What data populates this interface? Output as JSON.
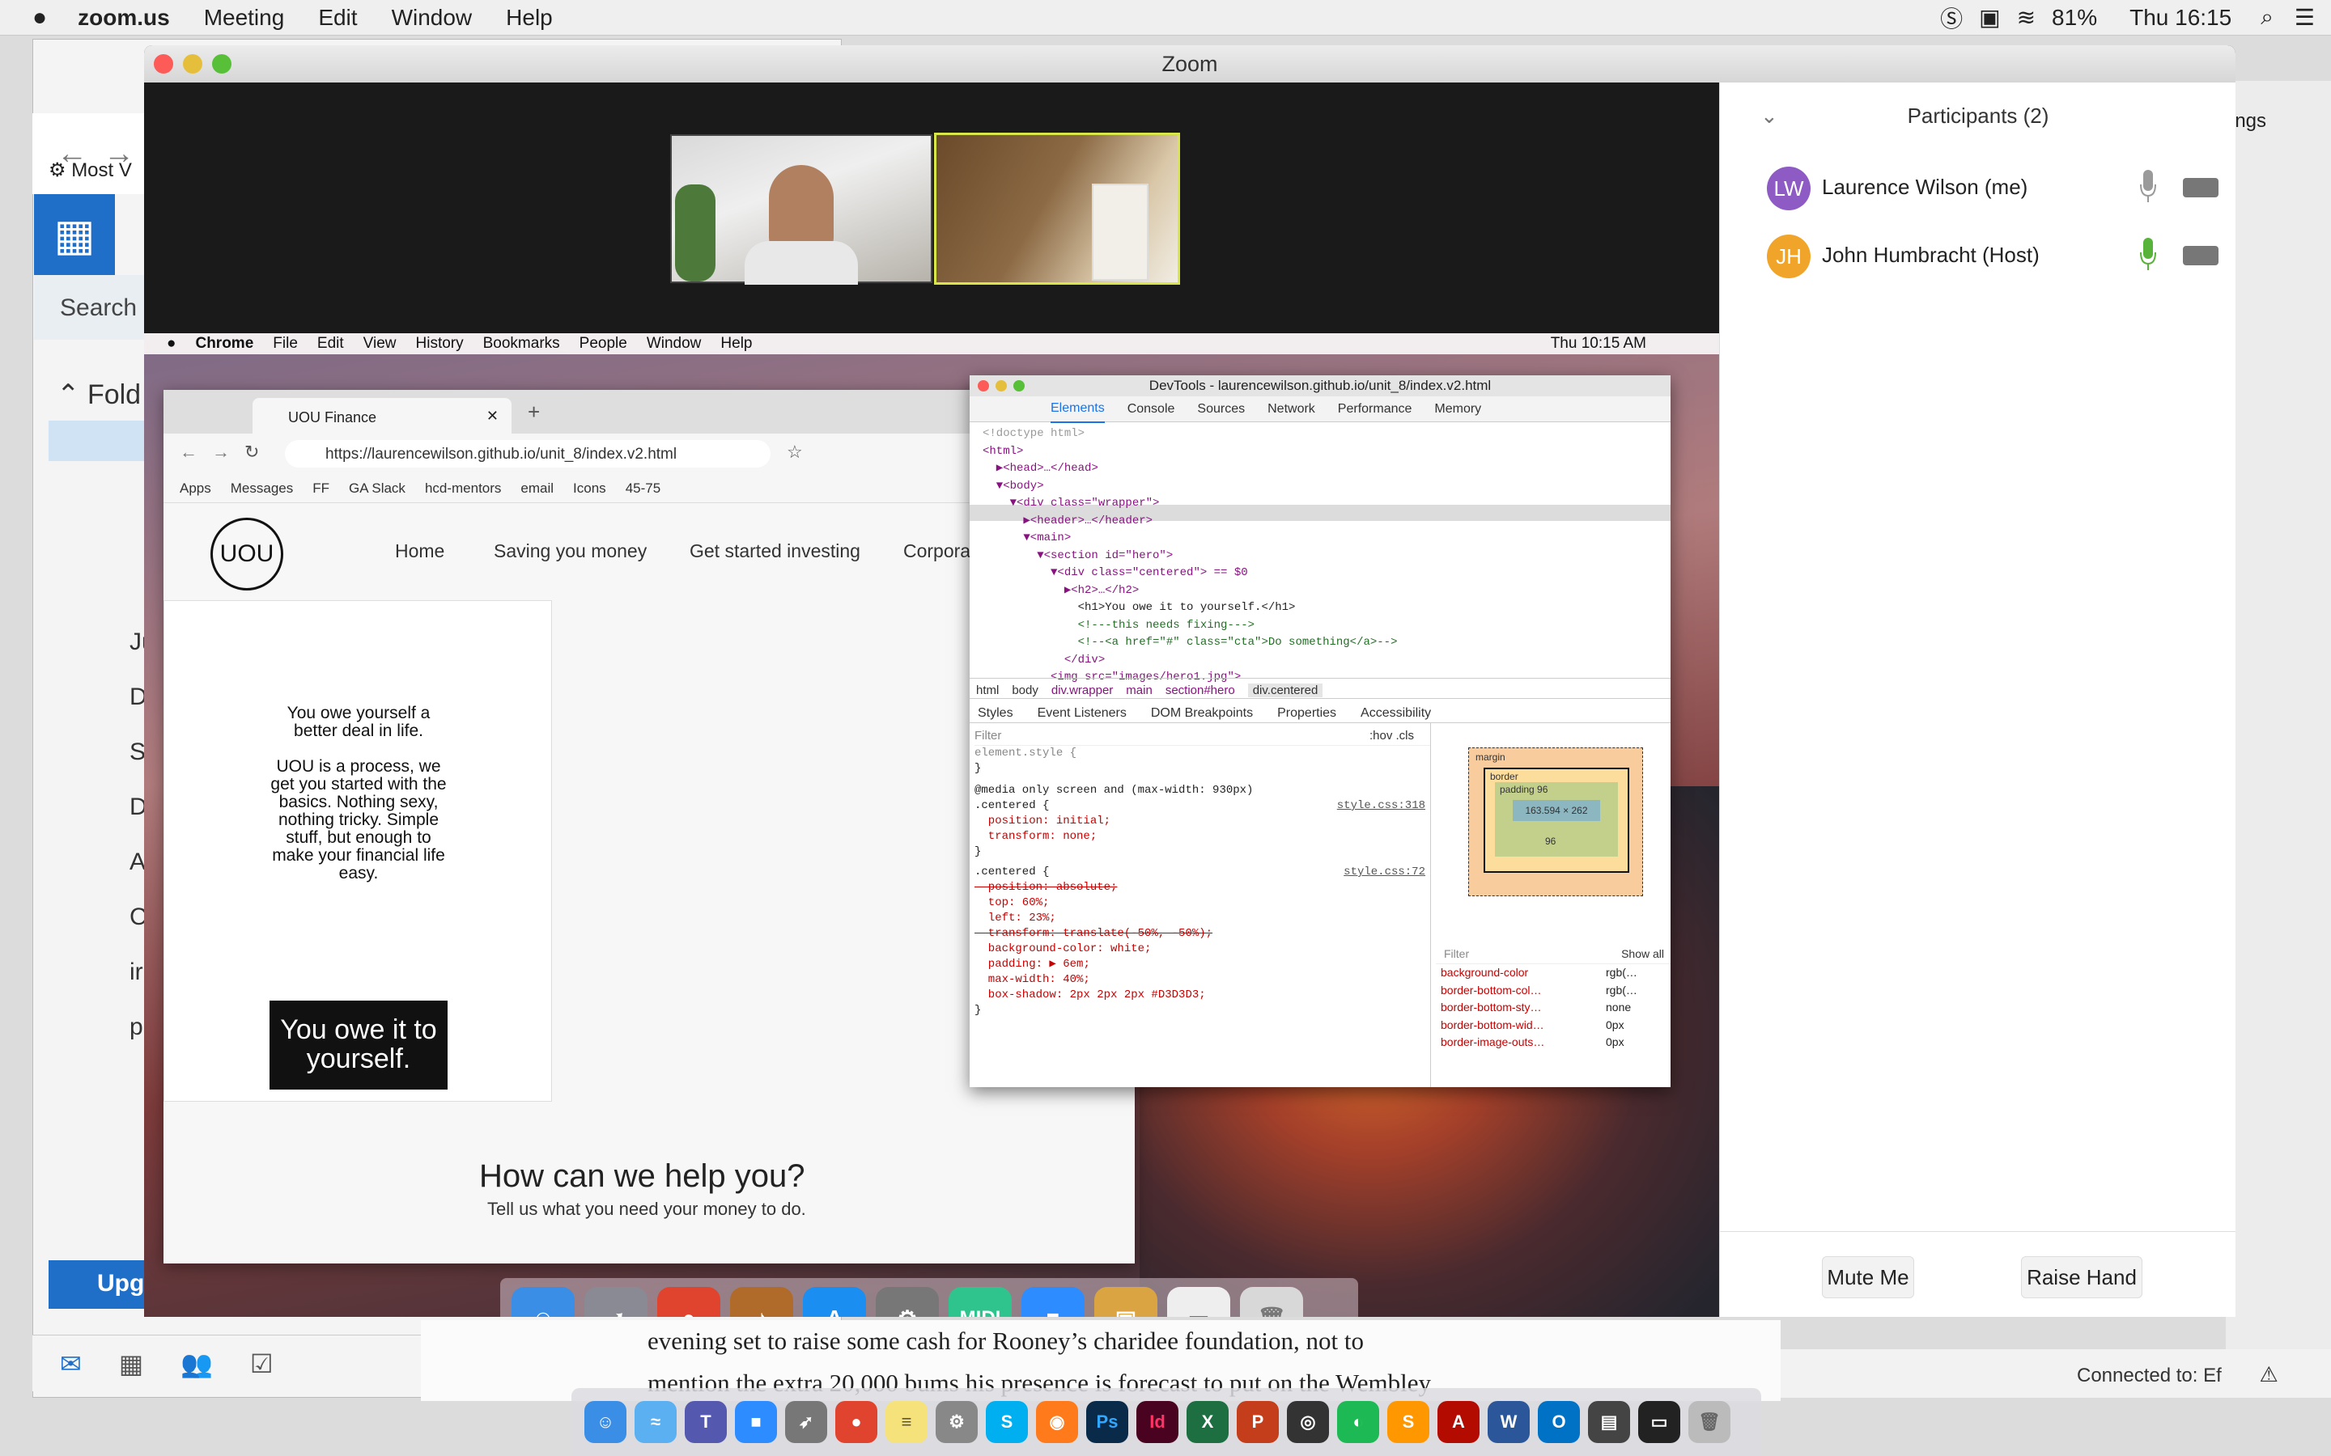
{
  "mac_menubar": {
    "app": "zoom.us",
    "items": [
      "Meeting",
      "Edit",
      "Window",
      "Help"
    ],
    "battery": "81%",
    "clock": "Thu 16:15"
  },
  "background": {
    "outlook": {
      "nav_label": "Most V",
      "folders_label": "Fold",
      "search_label": "Search M",
      "upgrade_label": "Upg",
      "side_letters": [
        "Ju",
        "D",
        "S",
        "D",
        "A",
        "C",
        "ir",
        "p"
      ]
    },
    "article_lines": [
      "evening set to raise some cash for Rooney’s charidee foundation, not to",
      "mention the extra 20,000 bums his presence is forecast to put on the Wembley"
    ],
    "connected_label": "Connected to: Ef",
    "right_snippet": "ings"
  },
  "zoom": {
    "window_title": "Zoom",
    "participants_title": "Participants (2)",
    "participants": [
      {
        "initials": "LW",
        "name": "Laurence Wilson (me)",
        "avatar_color": "#8e5bc4",
        "mic_color": "#999999"
      },
      {
        "initials": "JH",
        "name": "John Humbracht (Host)",
        "avatar_color": "#f0a52a",
        "mic_color": "#58b33a"
      }
    ],
    "mute_label": "Mute Me",
    "raise_hand_label": "Raise Hand"
  },
  "shared_screen": {
    "mac_menubar": {
      "app": "Chrome",
      "items": [
        "File",
        "Edit",
        "View",
        "History",
        "Bookmarks",
        "People",
        "Window",
        "Help"
      ],
      "clock": "Thu 10:15 AM"
    },
    "chrome": {
      "tab_title": "UOU Finance",
      "url": "https://laurencewilson.github.io/unit_8/index.v2.html",
      "bookmarks": [
        "Apps",
        "Messages",
        "FF",
        "GA Slack",
        "hcd-mentors",
        "email",
        "Icons",
        "45-75"
      ],
      "site": {
        "logo": "UOU",
        "nav": [
          "Home",
          "Saving you money",
          "Get started investing",
          "Corpora"
        ],
        "card_heading": "You owe yourself a better deal in life.",
        "card_body": "UOU is a process, we get you started with the basics. Nothing sexy, nothing tricky. Simple stuff, but enough to make your financial life easy.",
        "cta": "You owe it to yourself.",
        "help_title": "How can we help you?",
        "help_sub": "Tell us what you need your money to do."
      }
    },
    "devtools": {
      "title": "DevTools - laurencewilson.github.io/unit_8/index.v2.html",
      "tabs": [
        "Elements",
        "Console",
        "Sources",
        "Network",
        "Performance",
        "Memory"
      ],
      "dom_lines": [
        "<!doctype html>",
        "<html>",
        "  ▶<head>…</head>",
        "  ▼<body>",
        "    ▼<div class=\"wrapper\">",
        "      ▶<header>…</header>",
        "      ▼<main>",
        "        ▼<section id=\"hero\">",
        "          ▼<div class=\"centered\"> == $0",
        "            ▶<h2>…</h2>",
        "              <h1>You owe it to yourself.</h1>",
        "              <!---this needs fixing--->",
        "              <!--<a href=\"#\" class=\"cta\">Do something</a>-->",
        "            </div>",
        "          <img src=\"images/hero1.jpg\">"
      ],
      "breadcrumbs": [
        "html",
        "body",
        "div.wrapper",
        "main",
        "section#hero",
        "div.centered"
      ],
      "sub_tabs": [
        "Styles",
        "Event Listeners",
        "DOM Breakpoints",
        "Properties",
        "Accessibility"
      ],
      "filter_placeholder": "Filter",
      "hov_cls": ":hov  .cls",
      "styles": [
        "element.style {",
        "}",
        "@media only screen and (max-width: 930px)",
        ".centered {",
        "  position: initial;",
        "  transform: none;",
        "}",
        ".centered {",
        "  position: absolute;",
        "  top: 60%;",
        "  left: 23%;",
        "  transform: translate(-50%, -50%);",
        "  background-color: white;",
        "  padding: ▶ 6em;",
        "  max-width: 40%;",
        "  box-shadow: 2px 2px 2px #D3D3D3;",
        "}"
      ],
      "style_sources": [
        "style.css:318",
        "style.css:72"
      ],
      "box_model": {
        "margin": "margin",
        "border": "border",
        "padding": "padding 96",
        "content": "163.594 × 262",
        "side": "96"
      },
      "computed": [
        [
          "background-color",
          "rgb(…"
        ],
        [
          "border-bottom-col…",
          "rgb(…"
        ],
        [
          "border-bottom-sty…",
          "none"
        ],
        [
          "border-bottom-wid…",
          "0px"
        ],
        [
          "border-image-outs…",
          "0px"
        ]
      ],
      "show_all": "Show all"
    }
  }
}
